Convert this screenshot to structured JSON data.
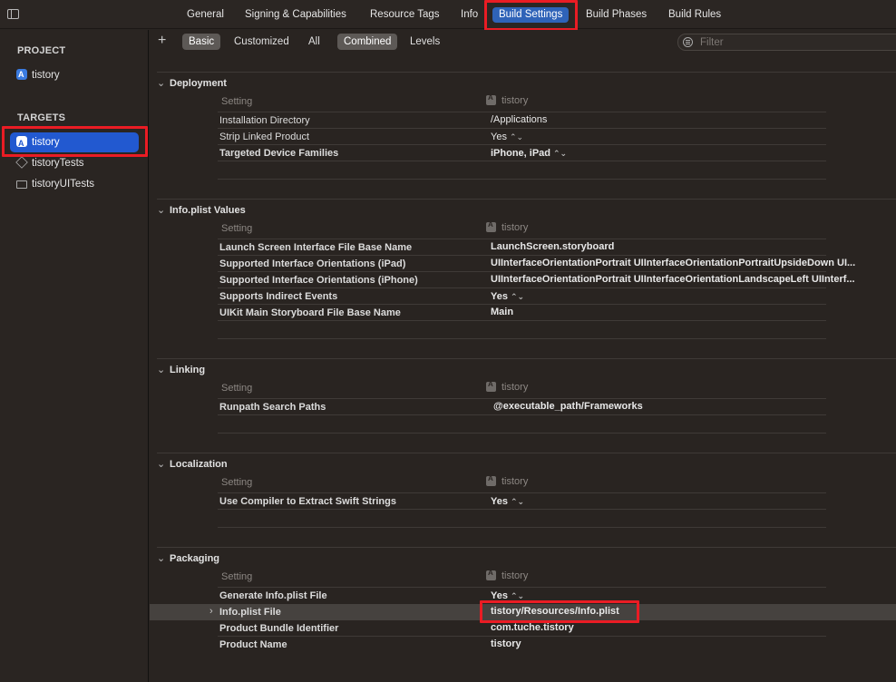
{
  "tabs": [
    {
      "label": "General"
    },
    {
      "label": "Signing & Capabilities"
    },
    {
      "label": "Resource Tags"
    },
    {
      "label": "Info"
    },
    {
      "label": "Build Settings"
    },
    {
      "label": "Build Phases"
    },
    {
      "label": "Build Rules"
    }
  ],
  "sidebar": {
    "project_title": "PROJECT",
    "project_item": "tistory",
    "targets_title": "TARGETS",
    "targets": [
      {
        "label": "tistory"
      },
      {
        "label": "tistoryTests"
      },
      {
        "label": "tistoryUITests"
      }
    ]
  },
  "filterbar": {
    "plus": "+",
    "scope": [
      "Basic",
      "Customized",
      "All"
    ],
    "view": [
      "Combined",
      "Levels"
    ],
    "filter_placeholder": "Filter"
  },
  "column_setting": "Setting",
  "column_target": "tistory",
  "stepper_glyph": "⌃⌄",
  "groups": [
    {
      "title": "Deployment",
      "rows": [
        {
          "label": "Installation Directory",
          "value": "/Applications",
          "bold": false
        },
        {
          "label": "Strip Linked Product",
          "value": "Yes",
          "bold": false
        },
        {
          "label": "Targeted Device Families",
          "value": "iPhone, iPad",
          "bold": true
        }
      ]
    },
    {
      "title": "Info.plist Values",
      "rows": [
        {
          "label": "Launch Screen Interface File Base Name",
          "value": "LaunchScreen.storyboard",
          "bold": true
        },
        {
          "label": "Supported Interface Orientations (iPad)",
          "value": "UIInterfaceOrientationPortrait UIInterfaceOrientationPortraitUpsideDown UI...",
          "bold": true
        },
        {
          "label": "Supported Interface Orientations (iPhone)",
          "value": "UIInterfaceOrientationPortrait UIInterfaceOrientationLandscapeLeft UIInterf...",
          "bold": true
        },
        {
          "label": "Supports Indirect Events",
          "value": "Yes",
          "bold": true
        },
        {
          "label": "UIKit Main Storyboard File Base Name",
          "value": "Main",
          "bold": true
        }
      ]
    },
    {
      "title": "Linking",
      "rows": [
        {
          "label": "Runpath Search Paths",
          "value": "@executable_path/Frameworks",
          "bold": true
        }
      ]
    },
    {
      "title": "Localization",
      "rows": [
        {
          "label": "Use Compiler to Extract Swift Strings",
          "value": "Yes",
          "bold": true
        }
      ]
    },
    {
      "title": "Packaging",
      "rows": [
        {
          "label": "Generate Info.plist File",
          "value": "Yes",
          "bold": true
        },
        {
          "label": "Info.plist File",
          "value": "tistory/Resources/Info.plist",
          "bold": true
        },
        {
          "label": "Product Bundle Identifier",
          "value": "com.tuche.tistory",
          "bold": true
        },
        {
          "label": "Product Name",
          "value": "tistory",
          "bold": true
        }
      ]
    }
  ]
}
